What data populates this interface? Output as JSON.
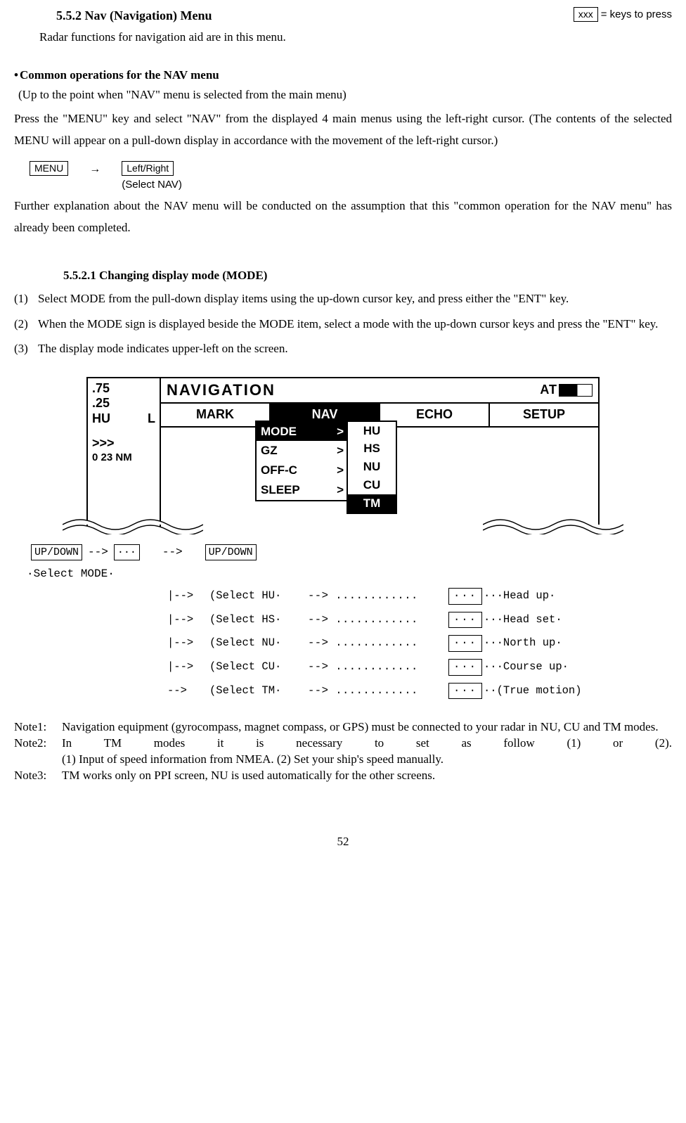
{
  "header": {
    "section_title": "5.5.2 Nav (Navigation) Menu",
    "legend_key": "xxx",
    "legend_text": "= keys to press"
  },
  "intro": "Radar functions for navigation aid are in this menu.",
  "common": {
    "heading": "Common operations for the NAV menu",
    "paren": "(Up to the point when \"NAV\" menu is selected from the main menu)",
    "para1": "Press the \"MENU\" key and select \"NAV\" from the displayed 4 main menus using the left-right cursor.  (The contents of the selected MENU will appear on a pull-down display in accordance with the movement of the left-right cursor.)",
    "seq": {
      "menu": "MENU",
      "arrow": "→",
      "lr": "Left/Right",
      "sub": "(Select NAV)"
    },
    "para2": "Further explanation about the NAV menu will be conducted on the assumption that this \"common operation for the NAV menu\" has already been completed."
  },
  "mode_section": {
    "heading": "5.5.2.1 Changing display mode  (MODE)",
    "items": [
      {
        "n": "(1)",
        "t": "Select MODE from the pull-down display items using the up-down cursor key, and press either the \"ENT\" key."
      },
      {
        "n": "(2)",
        "t": "When the MODE sign is displayed beside the MODE item, select a mode with the up-down cursor keys and press the \"ENT\" key."
      },
      {
        "n": "(3)",
        "t": "The display mode indicates upper-left on the screen."
      }
    ]
  },
  "radar": {
    "left": {
      "a": ".75",
      "b": ".25",
      "hu": "HU",
      "l": "L",
      "chev": ">>>",
      "range": "0 23 NM"
    },
    "title": "NAVIGATION",
    "at": "AT",
    "tabs": [
      "MARK",
      "NAV",
      "ECHO",
      "SETUP"
    ],
    "pulldown": [
      {
        "label": "MODE",
        "inv": true
      },
      {
        "label": "GZ",
        "inv": false
      },
      {
        "label": "OFF-C",
        "inv": false
      },
      {
        "label": "SLEEP",
        "inv": false
      }
    ],
    "mode_opts": [
      "HU",
      "HS",
      "NU",
      "CU",
      "TM"
    ]
  },
  "flow": {
    "head": {
      "updown1": "UP/DOWN",
      "arr": "-->",
      "dots": "···",
      "updown2": "UP/DOWN"
    },
    "label": "·Select MODE·",
    "rows": [
      {
        "pre": "|-->",
        "sel": "(Select HU·",
        "dots": "--> ............",
        "ent": "···",
        "desc": "···Head up·"
      },
      {
        "pre": "|-->",
        "sel": "(Select HS·",
        "dots": "--> ............",
        "ent": "···",
        "desc": "···Head set·"
      },
      {
        "pre": "|-->",
        "sel": "(Select NU·",
        "dots": "--> ............",
        "ent": "···",
        "desc": "···North up·"
      },
      {
        "pre": "|-->",
        "sel": "(Select CU·",
        "dots": "--> ............",
        "ent": "···",
        "desc": "···Course up·"
      },
      {
        "pre": " -->",
        "sel": "(Select TM·",
        "dots": "--> ............",
        "ent": "···",
        "desc": "··(True motion)"
      }
    ]
  },
  "notes": {
    "n1_lbl": "Note1:",
    "n1": "Navigation equipment (gyrocompass, magnet compass, or GPS) must be connected to your radar in NU, CU and TM modes.",
    "n2_lbl": "Note2:",
    "n2a": "In TM modes it is necessary to set as follow (1) or (2).",
    "n2b": "(1) Input of speed information from NMEA.      (2) Set your ship's speed manually.",
    "n3_lbl": "Note3:",
    "n3": "TM works only on PPI screen, NU is used automatically for the other screens."
  },
  "page": "52"
}
